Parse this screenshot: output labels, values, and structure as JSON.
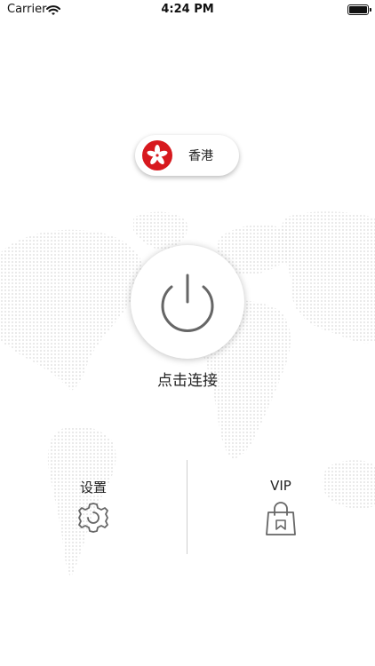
{
  "status_bar": {
    "carrier": "Carrier",
    "time": "4:24 PM",
    "icons": [
      "wifi-icon",
      "battery-icon"
    ]
  },
  "region": {
    "name": "香港",
    "flag": "hong-kong-flag-icon"
  },
  "power": {
    "icon": "power-icon",
    "label": "点击连接"
  },
  "menu": {
    "settings_label": "设置",
    "settings_icon": "gear-icon",
    "vip_label": "VIP",
    "vip_icon": "shopping-bag-icon"
  },
  "colors": {
    "flag_red": "#d7191e",
    "icon_gray": "#666666",
    "map_dots": "#e6e6e6"
  }
}
